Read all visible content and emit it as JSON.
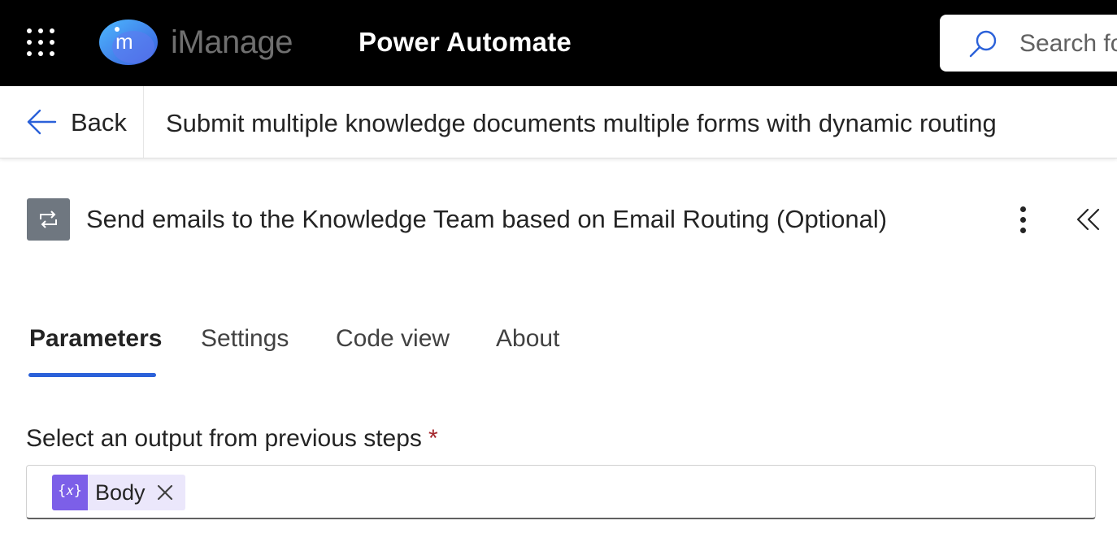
{
  "header": {
    "brand_name": "iManage",
    "brand_mark_letter": "m",
    "app_title": "Power Automate",
    "search_placeholder": "Search fo"
  },
  "command_bar": {
    "back_label": "Back",
    "flow_name": "Submit multiple knowledge documents multiple forms with dynamic routing"
  },
  "panel": {
    "action_title": "Send emails to the Knowledge Team based on Email Routing (Optional)",
    "action_icon": "loop-icon",
    "tabs": [
      {
        "label": "Parameters",
        "active": true
      },
      {
        "label": "Settings",
        "active": false
      },
      {
        "label": "Code view",
        "active": false
      },
      {
        "label": "About",
        "active": false
      }
    ]
  },
  "parameters": {
    "field_label": "Select an output from previous steps",
    "required_marker": "*",
    "token": {
      "icon_text": "{𝑥}",
      "label": "Body"
    }
  },
  "colors": {
    "topbar": "#000000",
    "accent": "#2b61d9",
    "action_icon_bg": "#6f7780",
    "token_icon_bg": "#7c5fe8",
    "token_bg": "#ebe7fb",
    "required": "#a4262c"
  }
}
